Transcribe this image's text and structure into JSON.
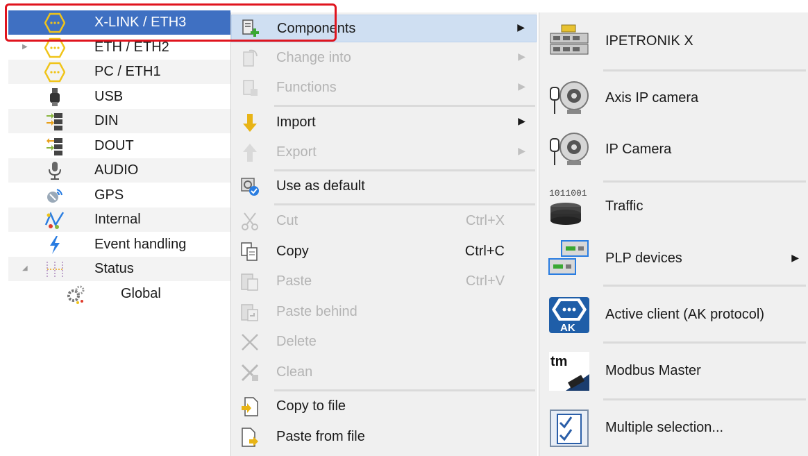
{
  "tree": {
    "items": [
      {
        "label": "X-LINK / ETH3",
        "icon": "xlink-icon",
        "selected": true
      },
      {
        "label": "ETH / ETH2",
        "icon": "ethernet-icon"
      },
      {
        "label": "PC / ETH1",
        "icon": "ethernet-icon"
      },
      {
        "label": "USB",
        "icon": "usb-icon"
      },
      {
        "label": "DIN",
        "icon": "digital-in-icon"
      },
      {
        "label": "DOUT",
        "icon": "digital-out-icon"
      },
      {
        "label": "AUDIO",
        "icon": "microphone-icon"
      },
      {
        "label": "GPS",
        "icon": "gps-icon"
      },
      {
        "label": "Internal",
        "icon": "internal-icon"
      },
      {
        "label": "Event handling",
        "icon": "lightning-icon"
      },
      {
        "label": "Status",
        "icon": "status-icon"
      },
      {
        "label": "Global",
        "icon": "gears-icon"
      }
    ]
  },
  "context_menu": {
    "items": [
      {
        "label": "Components",
        "icon": "components-icon",
        "submenu": true,
        "enabled": true
      },
      {
        "label": "Change into",
        "icon": "change-into-icon",
        "submenu": true,
        "enabled": false
      },
      {
        "label": "Functions",
        "icon": "functions-icon",
        "submenu": true,
        "enabled": false
      },
      {
        "label": "Import",
        "icon": "import-arrow-icon",
        "submenu": true,
        "enabled": true
      },
      {
        "label": "Export",
        "icon": "export-arrow-icon",
        "submenu": true,
        "enabled": false
      },
      {
        "label": "Use as default",
        "icon": "use-default-icon",
        "enabled": true
      },
      {
        "label": "Cut",
        "icon": "scissors-icon",
        "shortcut": "Ctrl+X",
        "enabled": false
      },
      {
        "label": "Copy",
        "icon": "copy-icon",
        "shortcut": "Ctrl+C",
        "enabled": true
      },
      {
        "label": "Paste",
        "icon": "paste-icon",
        "shortcut": "Ctrl+V",
        "enabled": false
      },
      {
        "label": "Paste behind",
        "icon": "paste-behind-icon",
        "enabled": false
      },
      {
        "label": "Delete",
        "icon": "delete-x-icon",
        "enabled": false
      },
      {
        "label": "Clean",
        "icon": "clean-icon",
        "enabled": false
      },
      {
        "label": "Copy to file",
        "icon": "copy-to-file-icon",
        "enabled": true
      },
      {
        "label": "Paste from file",
        "icon": "paste-from-file-icon",
        "enabled": true
      }
    ],
    "submenu_arrow": "▶"
  },
  "submenu": {
    "items": [
      {
        "label": "IPETRONIK X",
        "icon": "ipetronik-device-icon"
      },
      {
        "label": "Axis IP camera",
        "icon": "ip-camera-icon"
      },
      {
        "label": "IP Camera",
        "icon": "ip-camera-icon"
      },
      {
        "label": "Traffic",
        "icon": "traffic-database-icon",
        "icon_text": "1011001"
      },
      {
        "label": "PLP devices",
        "icon": "plp-devices-icon",
        "submenu": true
      },
      {
        "label": "Active client (AK protocol)",
        "icon": "ak-protocol-icon",
        "icon_text": "AK"
      },
      {
        "label": "Modbus Master",
        "icon": "modbus-icon",
        "icon_text": "tm"
      },
      {
        "label": "Multiple selection...",
        "icon": "checklist-icon"
      }
    ]
  },
  "colors": {
    "selection": "#3f70c2",
    "hover": "#cfdff2",
    "highlight_frame": "#e0141e",
    "disabled_text": "#b4b4b4",
    "menu_background": "#f0f0f0"
  }
}
